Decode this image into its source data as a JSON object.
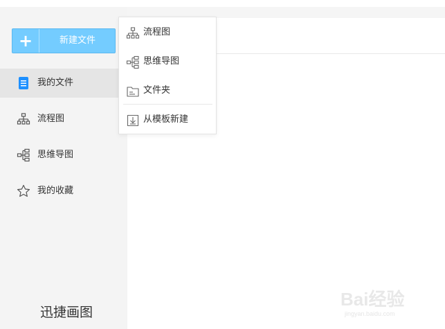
{
  "sidebar": {
    "new_button": {
      "icon": "plus-icon",
      "label": "新建文件",
      "color": "#74ccff"
    },
    "items": [
      {
        "label": "我的文件",
        "icon": "document-icon",
        "active": true
      },
      {
        "label": "流程图",
        "icon": "flowchart-icon",
        "active": false
      },
      {
        "label": "思维导图",
        "icon": "mindmap-icon",
        "active": false
      },
      {
        "label": "我的收藏",
        "icon": "star-icon",
        "active": false
      }
    ],
    "brand": "迅捷画图"
  },
  "dropdown": {
    "items": [
      {
        "label": "流程图",
        "icon": "flowchart-icon"
      },
      {
        "label": "思维导图",
        "icon": "mindmap-icon"
      },
      {
        "label": "文件夹",
        "icon": "folder-icon"
      },
      {
        "label": "从模板新建",
        "icon": "template-import-icon"
      }
    ]
  },
  "watermark": {
    "text": "Bai经验",
    "sub": "jingyan.baidu.com"
  },
  "colors": {
    "accent": "#74ccff",
    "active_bg": "#e5e5e5",
    "doc_icon": "#1e90ff"
  }
}
